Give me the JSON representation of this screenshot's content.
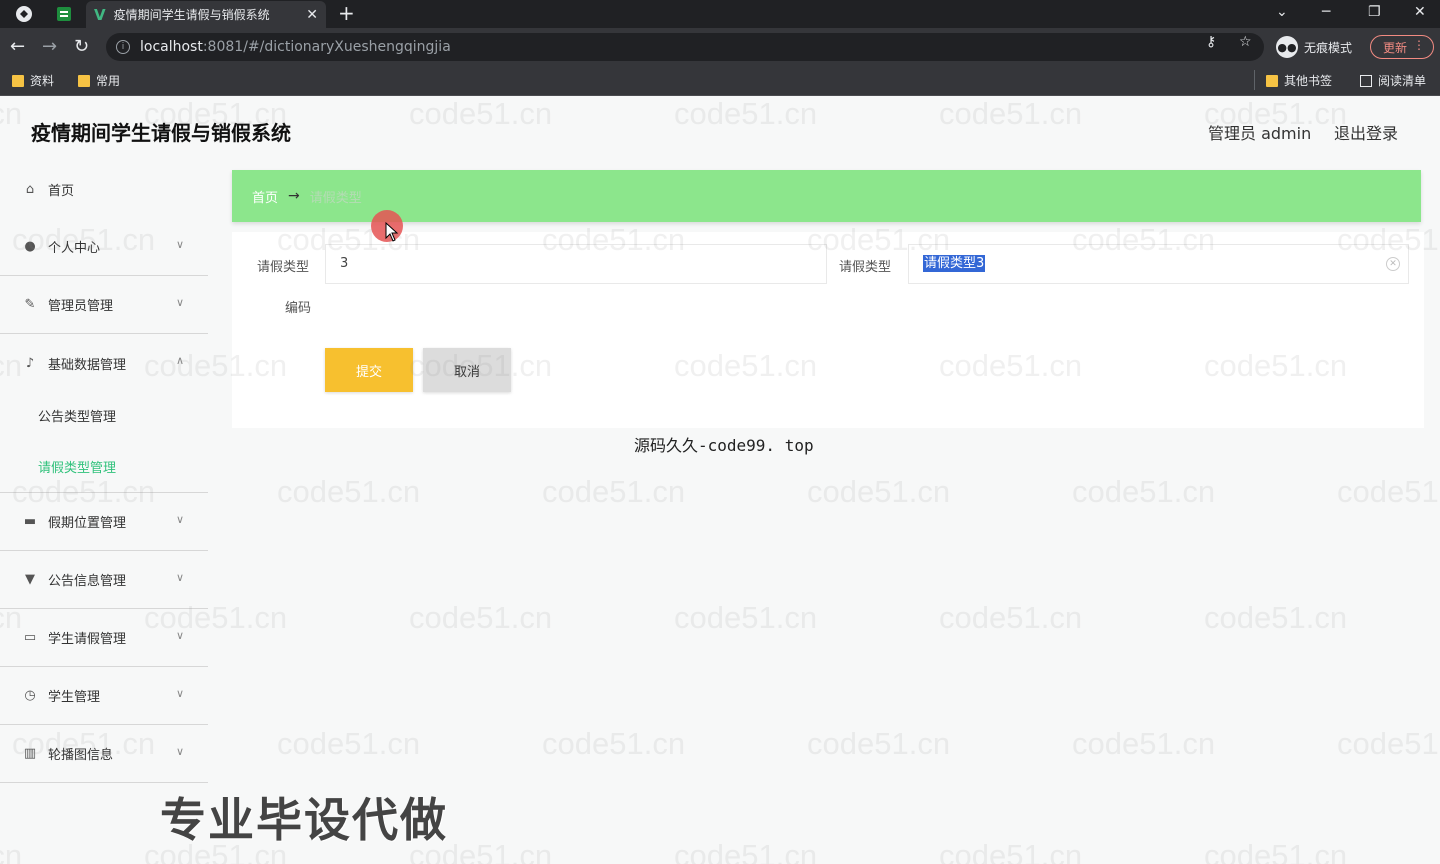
{
  "browser": {
    "tab_title": "疫情期间学生请假与销假系统",
    "tab_close": "✕",
    "new_tab": "+",
    "url_host": "localhost",
    "url_path": ":8081/#/dictionaryXueshengqingjia",
    "incognito_label": "无痕模式",
    "update_label": "更新",
    "bookmarks": [
      "资料",
      "常用"
    ],
    "other_bookmarks": "其他书签",
    "reading_list": "阅读清单"
  },
  "header": {
    "title": "疫情期间学生请假与销假系统",
    "user": "管理员 admin",
    "logout": "退出登录"
  },
  "sidebar": {
    "items": [
      {
        "label": "首页",
        "icon": "home-icon"
      },
      {
        "label": "个人中心",
        "icon": "user-icon"
      },
      {
        "label": "管理员管理",
        "icon": "edit-icon"
      },
      {
        "label": "基础数据管理",
        "icon": "microphone-icon"
      },
      {
        "label": "假期位置管理",
        "icon": "chat-icon"
      },
      {
        "label": "公告信息管理",
        "icon": "sign-icon"
      },
      {
        "label": "学生请假管理",
        "icon": "message-icon"
      },
      {
        "label": "学生管理",
        "icon": "clock-icon"
      },
      {
        "label": "轮播图信息",
        "icon": "chart-icon"
      }
    ],
    "submenu": [
      "公告类型管理",
      "请假类型管理"
    ]
  },
  "breadcrumb": {
    "home": "首页",
    "arrow": "→",
    "current": "请假类型"
  },
  "form": {
    "field1_label": "请假类型",
    "field1_value": "3",
    "field2_label": "请假类型",
    "field2_value": "请假类型3",
    "code_label": "编码",
    "submit": "提交",
    "cancel": "取消"
  },
  "overlays": {
    "caption": "源码久久-code99. top",
    "promo": "专业毕设代做",
    "watermark": "code51.cn"
  },
  "colors": {
    "breadcrumb_bg": "#8ce68c",
    "submit_bg": "#f7c02f",
    "active_menu": "#31c27c"
  }
}
